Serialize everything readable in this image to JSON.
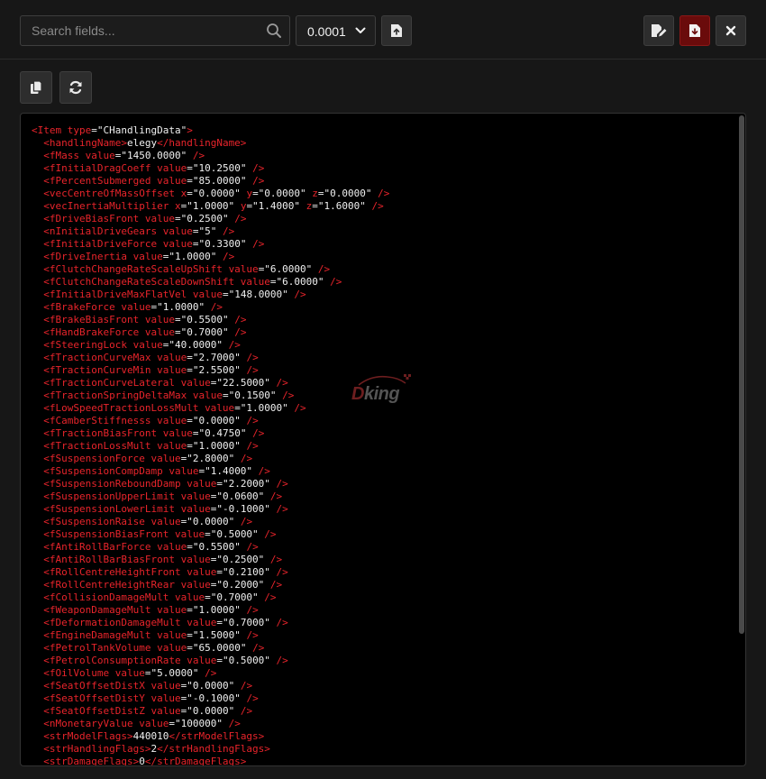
{
  "toolbar": {
    "search_placeholder": "Search fields...",
    "precision_value": "0.0001"
  },
  "watermark": {
    "d": "D",
    "rest": "king"
  },
  "code": {
    "open_tag": "Item",
    "open_attr": "type",
    "open_value": "\"CHandlingData\"",
    "lines": [
      {
        "kind": "text",
        "tag": "handlingName",
        "text": "elegy"
      },
      {
        "kind": "attr",
        "tag": "fMass",
        "attrs": [
          [
            "value",
            "\"1450.0000\""
          ]
        ]
      },
      {
        "kind": "attr",
        "tag": "fInitialDragCoeff",
        "attrs": [
          [
            "value",
            "\"10.2500\""
          ]
        ]
      },
      {
        "kind": "attr",
        "tag": "fPercentSubmerged",
        "attrs": [
          [
            "value",
            "\"85.0000\""
          ]
        ]
      },
      {
        "kind": "attr",
        "tag": "vecCentreOfMassOffset",
        "attrs": [
          [
            "x",
            "\"0.0000\""
          ],
          [
            "y",
            "\"0.0000\""
          ],
          [
            "z",
            "\"0.0000\""
          ]
        ]
      },
      {
        "kind": "attr",
        "tag": "vecInertiaMultiplier",
        "attrs": [
          [
            "x",
            "\"1.0000\""
          ],
          [
            "y",
            "\"1.4000\""
          ],
          [
            "z",
            "\"1.6000\""
          ]
        ]
      },
      {
        "kind": "attr",
        "tag": "fDriveBiasFront",
        "attrs": [
          [
            "value",
            "\"0.2500\""
          ]
        ]
      },
      {
        "kind": "attr",
        "tag": "nInitialDriveGears",
        "attrs": [
          [
            "value",
            "\"5\""
          ]
        ]
      },
      {
        "kind": "attr",
        "tag": "fInitialDriveForce",
        "attrs": [
          [
            "value",
            "\"0.3300\""
          ]
        ]
      },
      {
        "kind": "attr",
        "tag": "fDriveInertia",
        "attrs": [
          [
            "value",
            "\"1.0000\""
          ]
        ]
      },
      {
        "kind": "attr",
        "tag": "fClutchChangeRateScaleUpShift",
        "attrs": [
          [
            "value",
            "\"6.0000\""
          ]
        ]
      },
      {
        "kind": "attr",
        "tag": "fClutchChangeRateScaleDownShift",
        "attrs": [
          [
            "value",
            "\"6.0000\""
          ]
        ]
      },
      {
        "kind": "attr",
        "tag": "fInitialDriveMaxFlatVel",
        "attrs": [
          [
            "value",
            "\"148.0000\""
          ]
        ]
      },
      {
        "kind": "attr",
        "tag": "fBrakeForce",
        "attrs": [
          [
            "value",
            "\"1.0000\""
          ]
        ]
      },
      {
        "kind": "attr",
        "tag": "fBrakeBiasFront",
        "attrs": [
          [
            "value",
            "\"0.5500\""
          ]
        ]
      },
      {
        "kind": "attr",
        "tag": "fHandBrakeForce",
        "attrs": [
          [
            "value",
            "\"0.7000\""
          ]
        ]
      },
      {
        "kind": "attr",
        "tag": "fSteeringLock",
        "attrs": [
          [
            "value",
            "\"40.0000\""
          ]
        ]
      },
      {
        "kind": "attr",
        "tag": "fTractionCurveMax",
        "attrs": [
          [
            "value",
            "\"2.7000\""
          ]
        ]
      },
      {
        "kind": "attr",
        "tag": "fTractionCurveMin",
        "attrs": [
          [
            "value",
            "\"2.5500\""
          ]
        ]
      },
      {
        "kind": "attr",
        "tag": "fTractionCurveLateral",
        "attrs": [
          [
            "value",
            "\"22.5000\""
          ]
        ]
      },
      {
        "kind": "attr",
        "tag": "fTractionSpringDeltaMax",
        "attrs": [
          [
            "value",
            "\"0.1500\""
          ]
        ]
      },
      {
        "kind": "attr",
        "tag": "fLowSpeedTractionLossMult",
        "attrs": [
          [
            "value",
            "\"1.0000\""
          ]
        ]
      },
      {
        "kind": "attr",
        "tag": "fCamberStiffnesss",
        "attrs": [
          [
            "value",
            "\"0.0000\""
          ]
        ]
      },
      {
        "kind": "attr",
        "tag": "fTractionBiasFront",
        "attrs": [
          [
            "value",
            "\"0.4750\""
          ]
        ]
      },
      {
        "kind": "attr",
        "tag": "fTractionLossMult",
        "attrs": [
          [
            "value",
            "\"1.0000\""
          ]
        ]
      },
      {
        "kind": "attr",
        "tag": "fSuspensionForce",
        "attrs": [
          [
            "value",
            "\"2.8000\""
          ]
        ]
      },
      {
        "kind": "attr",
        "tag": "fSuspensionCompDamp",
        "attrs": [
          [
            "value",
            "\"1.4000\""
          ]
        ]
      },
      {
        "kind": "attr",
        "tag": "fSuspensionReboundDamp",
        "attrs": [
          [
            "value",
            "\"2.2000\""
          ]
        ]
      },
      {
        "kind": "attr",
        "tag": "fSuspensionUpperLimit",
        "attrs": [
          [
            "value",
            "\"0.0600\""
          ]
        ]
      },
      {
        "kind": "attr",
        "tag": "fSuspensionLowerLimit",
        "attrs": [
          [
            "value",
            "\"-0.1000\""
          ]
        ]
      },
      {
        "kind": "attr",
        "tag": "fSuspensionRaise",
        "attrs": [
          [
            "value",
            "\"0.0000\""
          ]
        ]
      },
      {
        "kind": "attr",
        "tag": "fSuspensionBiasFront",
        "attrs": [
          [
            "value",
            "\"0.5000\""
          ]
        ]
      },
      {
        "kind": "attr",
        "tag": "fAntiRollBarForce",
        "attrs": [
          [
            "value",
            "\"0.5500\""
          ]
        ]
      },
      {
        "kind": "attr",
        "tag": "fAntiRollBarBiasFront",
        "attrs": [
          [
            "value",
            "\"0.2500\""
          ]
        ]
      },
      {
        "kind": "attr",
        "tag": "fRollCentreHeightFront",
        "attrs": [
          [
            "value",
            "\"0.2100\""
          ]
        ]
      },
      {
        "kind": "attr",
        "tag": "fRollCentreHeightRear",
        "attrs": [
          [
            "value",
            "\"0.2000\""
          ]
        ]
      },
      {
        "kind": "attr",
        "tag": "fCollisionDamageMult",
        "attrs": [
          [
            "value",
            "\"0.7000\""
          ]
        ]
      },
      {
        "kind": "attr",
        "tag": "fWeaponDamageMult",
        "attrs": [
          [
            "value",
            "\"1.0000\""
          ]
        ]
      },
      {
        "kind": "attr",
        "tag": "fDeformationDamageMult",
        "attrs": [
          [
            "value",
            "\"0.7000\""
          ]
        ]
      },
      {
        "kind": "attr",
        "tag": "fEngineDamageMult",
        "attrs": [
          [
            "value",
            "\"1.5000\""
          ]
        ]
      },
      {
        "kind": "attr",
        "tag": "fPetrolTankVolume",
        "attrs": [
          [
            "value",
            "\"65.0000\""
          ]
        ]
      },
      {
        "kind": "attr",
        "tag": "fPetrolConsumptionRate",
        "attrs": [
          [
            "value",
            "\"0.5000\""
          ]
        ]
      },
      {
        "kind": "attr",
        "tag": "fOilVolume",
        "attrs": [
          [
            "value",
            "\"5.0000\""
          ]
        ]
      },
      {
        "kind": "attr",
        "tag": "fSeatOffsetDistX",
        "attrs": [
          [
            "value",
            "\"0.0000\""
          ]
        ]
      },
      {
        "kind": "attr",
        "tag": "fSeatOffsetDistY",
        "attrs": [
          [
            "value",
            "\"-0.1000\""
          ]
        ]
      },
      {
        "kind": "attr",
        "tag": "fSeatOffsetDistZ",
        "attrs": [
          [
            "value",
            "\"0.0000\""
          ]
        ]
      },
      {
        "kind": "attr",
        "tag": "nMonetaryValue",
        "attrs": [
          [
            "value",
            "\"100000\""
          ]
        ]
      },
      {
        "kind": "text",
        "tag": "strModelFlags",
        "text": "440010"
      },
      {
        "kind": "text",
        "tag": "strHandlingFlags",
        "text": "2"
      },
      {
        "kind": "text",
        "tag": "strDamageFlags",
        "text": "0"
      }
    ]
  }
}
